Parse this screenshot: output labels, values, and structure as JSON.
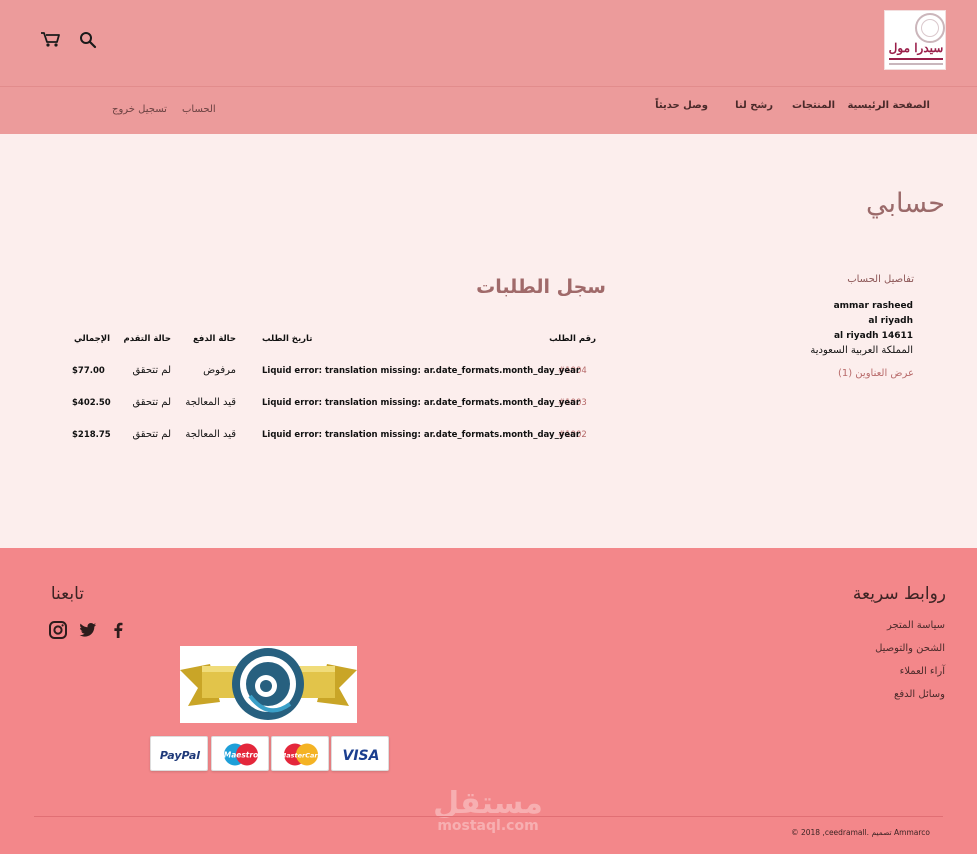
{
  "header": {
    "logo_text": "سيدرا مول",
    "nav": [
      "الصفحة الرئيسية",
      "المنتجات",
      "رشح لنا",
      "وصل حديثاً"
    ],
    "account_link": "الحساب",
    "logout_link": "تسجيل خروج"
  },
  "main": {
    "page_title": "حسابي",
    "account_details": {
      "heading": "تفاصيل الحساب",
      "name": "ammar rasheed",
      "city": "al riyadh",
      "city_zip": "al riyadh 14611",
      "country": "المملكة العربية السعودية",
      "view_addresses": "عرض العناوين (1)"
    },
    "orders": {
      "title": "سجل الطلبات",
      "headers": [
        "رقم الطلب",
        "تاريخ الطلب",
        "حالة الدفع",
        "حالة التقدم",
        "الإجمالي"
      ],
      "rows": [
        {
          "number": "#1004",
          "date": "Liquid error: translation missing: ar.date_formats.month_day_year",
          "payment": "مرفوض",
          "fulfillment": "لم تتحقق",
          "total": "$77.00"
        },
        {
          "number": "#1003",
          "date": "Liquid error: translation missing: ar.date_formats.month_day_year",
          "payment": "قيد المعالجة",
          "fulfillment": "لم تتحقق",
          "total": "$402.50"
        },
        {
          "number": "#1002",
          "date": "Liquid error: translation missing: ar.date_formats.month_day_year",
          "payment": "قيد المعالجة",
          "fulfillment": "لم تتحقق",
          "total": "$218.75"
        }
      ]
    }
  },
  "footer": {
    "quick_links_title": "روابط سريعة",
    "quick_links": [
      "سياسة المتجر",
      "الشحن والتوصيل",
      "آراء العملاء",
      "وسائل الدفع"
    ],
    "follow_title": "تابعنا",
    "social_icons": [
      "facebook-icon",
      "twitter-icon",
      "instagram-icon"
    ],
    "payment_cards": [
      "PayPal",
      "Maestro",
      "MasterCard",
      "VISA"
    ],
    "copyright": "© 2018 ,ceedramall. تصميم Ammarco",
    "watermark_ar": "مستقل",
    "watermark_en": "mostaql.com"
  },
  "colors": {
    "header_bg": "#ec9b9b",
    "page_bg": "#fceeed",
    "footer_bg": "#f3878a",
    "link": "#b66a6a"
  }
}
